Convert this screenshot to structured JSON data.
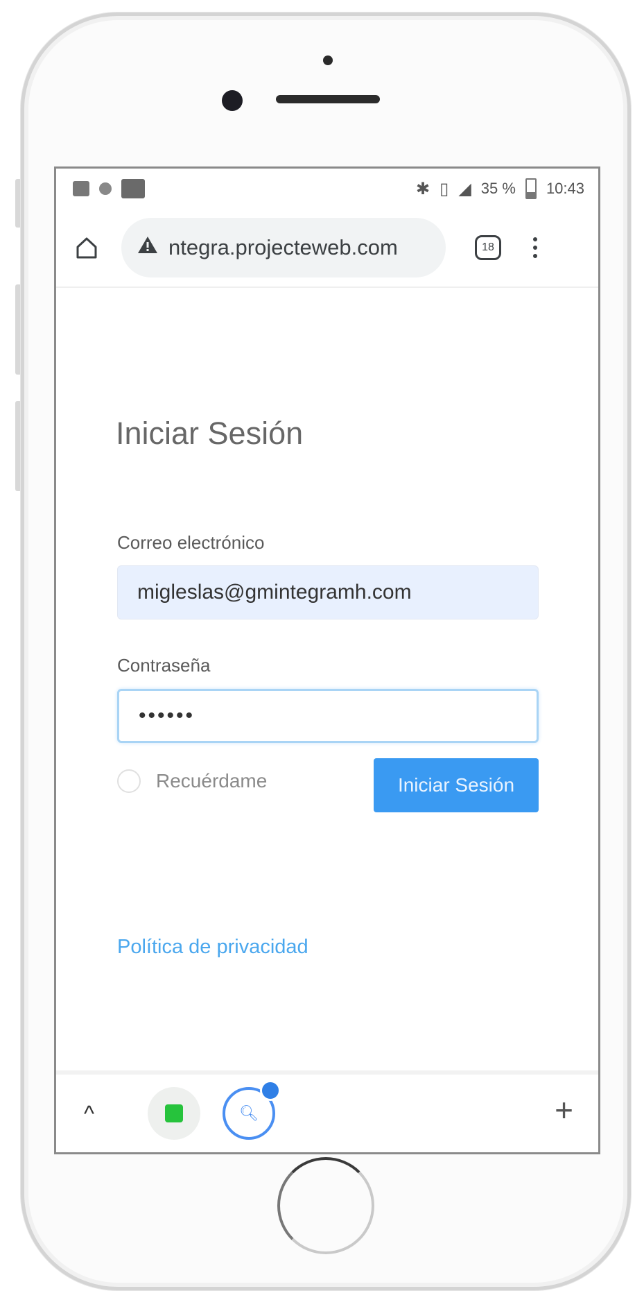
{
  "status_bar": {
    "battery": "35 %",
    "time": "10:43"
  },
  "browser": {
    "url": "ntegra.projecteweb.com",
    "tab_count": "18"
  },
  "login": {
    "title": "Iniciar Sesión",
    "email_label": "Correo electrónico",
    "email_value": "migleslas@gmintegramh.com",
    "password_label": "Contraseña",
    "password_value": "••••••",
    "remember_label": "Recuérdame",
    "submit_label": "Iniciar Sesión",
    "privacy_link": "Política de privacidad"
  },
  "bottom_bar": {
    "chevron": "^",
    "new_tab": "+"
  },
  "icons": {
    "warning": "warning-icon",
    "home": "home-icon",
    "tabs": "tab-switcher-icon",
    "menu": "more-vert-icon",
    "search": "search-icon"
  },
  "colors": {
    "primary_button": "#3a9af2",
    "link": "#4aa7ee",
    "email_field_bg": "#e8f0fe",
    "focus_border": "#a9d4f5"
  }
}
